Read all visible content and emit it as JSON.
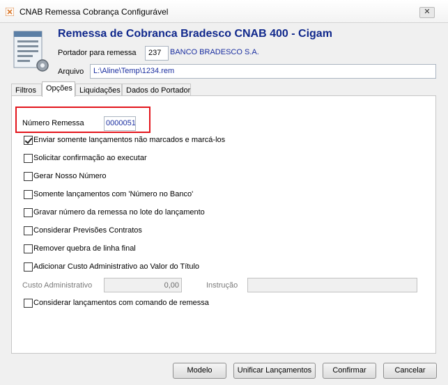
{
  "window": {
    "title": "CNAB Remessa Cobrança Configurável",
    "close_label": "✕"
  },
  "header": {
    "title": "Remessa de Cobranca Bradesco CNAB 400 - Cigam",
    "portador_label": "Portador para remessa",
    "portador_code": "237",
    "portador_name": "BANCO BRADESCO S.A.",
    "arquivo_label": "Arquivo",
    "arquivo_value": "L:\\Aline\\Temp\\1234.rem"
  },
  "tabs": [
    {
      "label": "Filtros"
    },
    {
      "label": "Opções"
    },
    {
      "label": "Liquidações"
    },
    {
      "label": "Dados do Portador"
    }
  ],
  "options": {
    "numero_remessa_label": "Número Remessa",
    "numero_remessa_value": "0000051",
    "checkboxes": [
      {
        "label": "Enviar somente lançamentos não marcados e marcá-los",
        "checked": true
      },
      {
        "label": "Solicitar confirmação ao executar",
        "checked": false
      },
      {
        "label": "Gerar Nosso Número",
        "checked": false
      },
      {
        "label": "Somente lançamentos com 'Número no Banco'",
        "checked": false
      },
      {
        "label": "Gravar número da remessa no lote do lançamento",
        "checked": false
      },
      {
        "label": "Considerar Previsões Contratos",
        "checked": false
      },
      {
        "label": "Remover quebra de linha final",
        "checked": false
      },
      {
        "label": "Adicionar Custo Administrativo ao Valor do Título",
        "checked": false
      },
      {
        "label": "Considerar lançamentos com comando de remessa",
        "checked": false
      }
    ],
    "custo_label": "Custo Administrativo",
    "custo_value": "0,00",
    "instrucao_label": "Instrução",
    "instrucao_value": ""
  },
  "buttons": {
    "modelo": "Modelo",
    "unificar": "Unificar Lançamentos",
    "confirmar": "Confirmar",
    "cancelar": "Cancelar"
  },
  "colors": {
    "title_blue": "#10288c",
    "highlight_red": "#e3141b"
  }
}
